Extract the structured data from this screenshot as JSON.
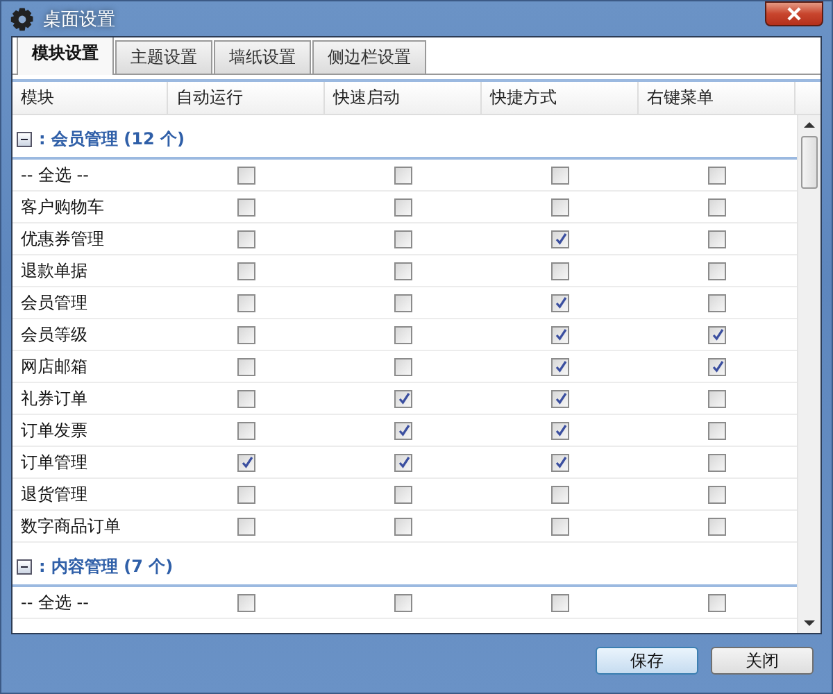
{
  "window": {
    "title": "桌面设置"
  },
  "tabs": [
    {
      "label": "模块设置",
      "selected": true
    },
    {
      "label": "主题设置",
      "selected": false
    },
    {
      "label": "墙纸设置",
      "selected": false
    },
    {
      "label": "侧边栏设置",
      "selected": false
    }
  ],
  "table": {
    "columns": [
      "模块",
      "自动运行",
      "快速启动",
      "快捷方式",
      "右键菜单"
    ],
    "groups": [
      {
        "title": ": 会员管理 (12 个)",
        "expanded": true,
        "rows": [
          {
            "name": "-- 全选 --",
            "checks": [
              false,
              false,
              false,
              false
            ]
          },
          {
            "name": "客户购物车",
            "checks": [
              false,
              false,
              false,
              false
            ]
          },
          {
            "name": "优惠券管理",
            "checks": [
              false,
              false,
              true,
              false
            ]
          },
          {
            "name": "退款单据",
            "checks": [
              false,
              false,
              false,
              false
            ]
          },
          {
            "name": "会员管理",
            "checks": [
              false,
              false,
              true,
              false
            ]
          },
          {
            "name": "会员等级",
            "checks": [
              false,
              false,
              true,
              true
            ]
          },
          {
            "name": "网店邮箱",
            "checks": [
              false,
              false,
              true,
              true
            ]
          },
          {
            "name": "礼券订单",
            "checks": [
              false,
              true,
              true,
              false
            ]
          },
          {
            "name": "订单发票",
            "checks": [
              false,
              true,
              true,
              false
            ]
          },
          {
            "name": "订单管理",
            "checks": [
              true,
              true,
              true,
              false
            ]
          },
          {
            "name": "退货管理",
            "checks": [
              false,
              false,
              false,
              false
            ]
          },
          {
            "name": "数字商品订单",
            "checks": [
              false,
              false,
              false,
              false
            ]
          }
        ]
      },
      {
        "title": ": 内容管理 (7 个)",
        "expanded": true,
        "rows": [
          {
            "name": "-- 全选 --",
            "checks": [
              false,
              false,
              false,
              false
            ]
          }
        ]
      }
    ]
  },
  "buttons": [
    "保存",
    "关闭"
  ]
}
